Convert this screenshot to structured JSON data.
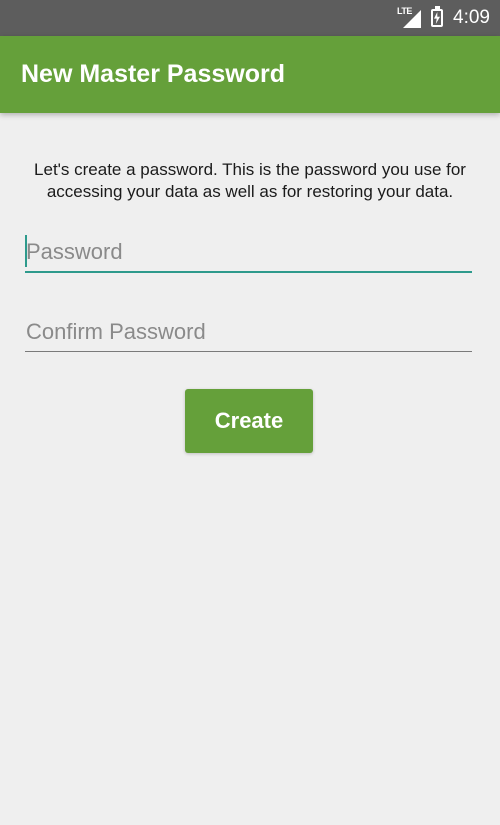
{
  "status_bar": {
    "network": "LTE",
    "time": "4:09",
    "icons": [
      "lte-signal-icon",
      "battery-charging-icon"
    ]
  },
  "app_bar": {
    "title": "New Master Password",
    "color": "#65a03a"
  },
  "main": {
    "description": "Let's create a password. This is the password you use for accessing your data as well as for restoring your data.",
    "password": {
      "value": "",
      "placeholder": "Password"
    },
    "confirm_password": {
      "value": "",
      "placeholder": "Confirm Password"
    },
    "create_label": "Create"
  },
  "colors": {
    "accent": "#2e9a8c",
    "primary": "#65a03a",
    "background": "#efefef"
  }
}
